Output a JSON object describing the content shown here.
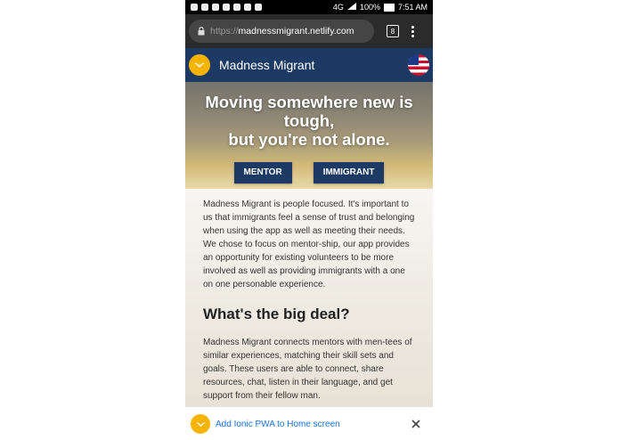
{
  "status_bar": {
    "battery": "100%",
    "time": "7:51 AM",
    "network": "4G"
  },
  "browser": {
    "url_scheme": "https://",
    "url_host": "madnessmigrant.netlify.com",
    "tab_count": "8"
  },
  "header": {
    "brand": "Madness Migrant"
  },
  "hero": {
    "title_line1": "Moving somewhere new is tough,",
    "title_line2": "but you're not alone.",
    "buttons": [
      "MENTOR",
      "IMMIGRANT"
    ]
  },
  "content": {
    "intro": "Madness Migrant is people focused. It's important to us that immigrants feel a sense of trust and belonging when using the app as well as meeting their needs. We chose to focus on mentor-ship, our app provides an opportunity for existing volunteers to be more involved as well as providing immigrants with a one on one personable experience.",
    "section_title": "What's the big deal?",
    "section_body": "Madness Migrant connects mentors with men-tees of similar experiences, matching their skill sets and goals. These users are able to connect, share resources, chat, listen in their language, and get support from their fellow man."
  },
  "install_banner": {
    "text": "Add Ionic PWA to Home screen"
  },
  "colors": {
    "header_bg": "#1d3a64",
    "logo_yellow": "#f4b400",
    "link_blue": "#1a73e8"
  },
  "icons": [
    "lock-icon",
    "tabs-icon",
    "menu-icon",
    "logo-icon",
    "flag-icon",
    "close-icon"
  ]
}
